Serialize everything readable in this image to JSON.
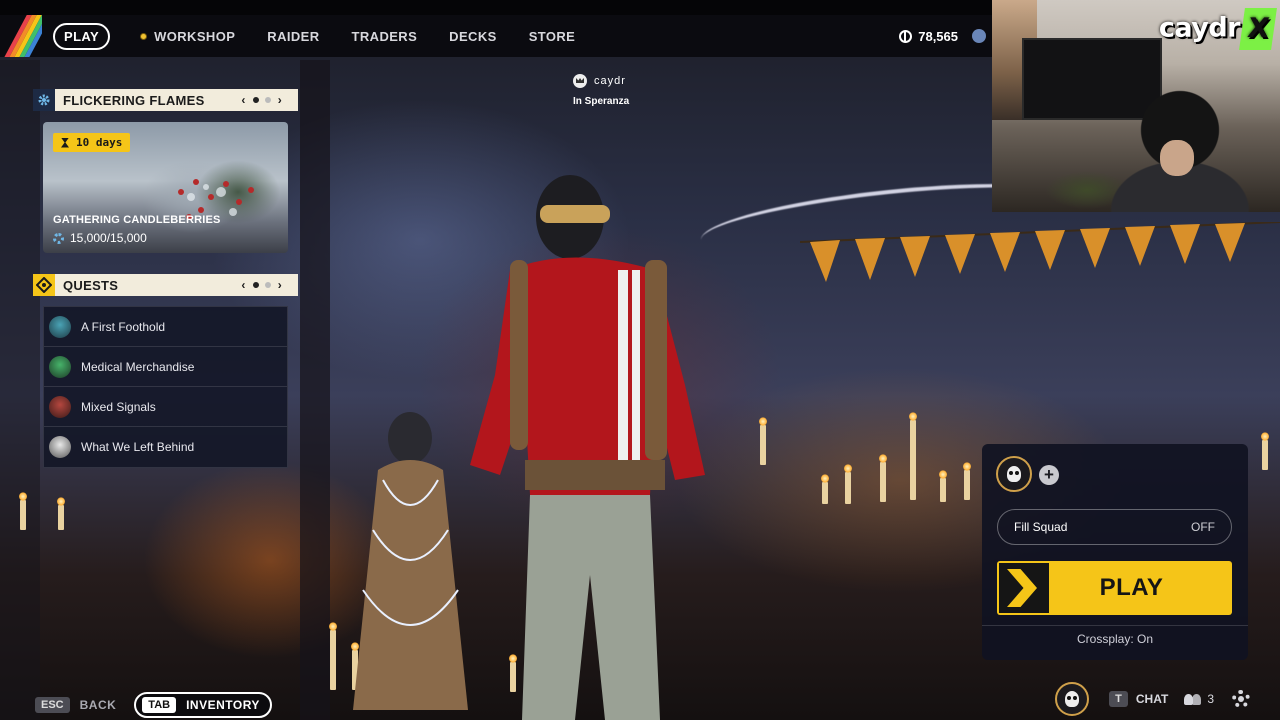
{
  "topbar": {
    "nav": [
      {
        "label": "PLAY",
        "active": true
      },
      {
        "label": "WORKSHOP",
        "active": false,
        "dot": true
      },
      {
        "label": "RAIDER",
        "active": false
      },
      {
        "label": "TRADERS",
        "active": false
      },
      {
        "label": "DECKS",
        "active": false
      },
      {
        "label": "STORE",
        "active": false
      }
    ],
    "currency_value": "78,565",
    "currency_icon": "coin-icon",
    "stripe_colors": [
      "#e8424a",
      "#f28c28",
      "#f5c518",
      "#3fbf6a",
      "#3b82d6"
    ]
  },
  "player": {
    "name": "caydr",
    "location": "In Speranza",
    "icon": "crown-icon"
  },
  "event": {
    "header": "FLICKERING FLAMES",
    "header_icon": "gear-icon",
    "timer": "10 days",
    "title": "GATHERING CANDLEBERRIES",
    "progress": "15,000/15,000",
    "pager_prev": "‹",
    "pager_next": "›"
  },
  "quests": {
    "header": "QUESTS",
    "header_icon": "diamond-icon",
    "pager_prev": "‹",
    "pager_next": "›",
    "items": [
      {
        "label": "A First Foothold",
        "color": "#4aa3b5"
      },
      {
        "label": "Medical Merchandise",
        "color": "#47b36a"
      },
      {
        "label": "Mixed Signals",
        "color": "#b5473f"
      },
      {
        "label": "What We Left Behind",
        "color": "#c8c8c8"
      }
    ]
  },
  "webcam": {
    "logo": "caydr",
    "logo_mark": "X"
  },
  "squad": {
    "add_label": "+",
    "fill_squad_label": "Fill Squad",
    "fill_squad_state": "OFF",
    "play_label": "PLAY",
    "crossplay": "Crossplay: On"
  },
  "bottom": {
    "back_key": "ESC",
    "back_label": "BACK",
    "inventory_key": "TAB",
    "inventory_label": "INVENTORY",
    "chat_key": "T",
    "chat_label": "CHAT",
    "squad_count": "3"
  },
  "colors": {
    "accent_yellow": "#f5c518",
    "panel_header": "#f2ecdc",
    "panel_bg": "#121626"
  }
}
